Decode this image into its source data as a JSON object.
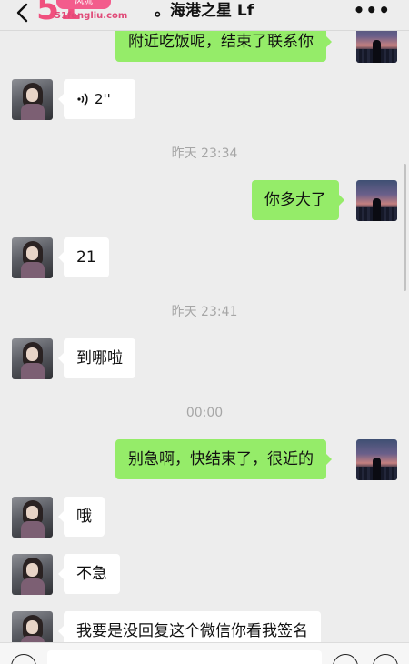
{
  "header": {
    "logo": {
      "number": "51",
      "pill": "风流",
      "url": "51fengliu.com"
    },
    "title": "。海港之星 Lf"
  },
  "messages": [
    {
      "from": "me",
      "text": "附近吃饭呢，结束了联系你"
    },
    {
      "from": "her",
      "type": "voice",
      "duration": "2''"
    },
    {
      "type": "time",
      "text": "昨天 23:34"
    },
    {
      "from": "me",
      "text": "你多大了"
    },
    {
      "from": "her",
      "text": "21"
    },
    {
      "type": "time",
      "text": "昨天 23:41"
    },
    {
      "from": "her",
      "text": "到哪啦"
    },
    {
      "type": "time",
      "text": "00:00"
    },
    {
      "from": "me",
      "text": "别急啊，快结束了，很近的"
    },
    {
      "from": "her",
      "text": "哦"
    },
    {
      "from": "her",
      "text": "不急"
    },
    {
      "from": "her",
      "text": "我要是没回复这个微信你看我签名"
    }
  ],
  "icons": {
    "back": "chevron-left-icon",
    "more": "more-dots-icon",
    "voice_bubble": "voice-wave-icon",
    "voice_input": "voice-input-icon",
    "emoji": "emoji-icon",
    "plus": "plus-icon"
  },
  "colors": {
    "background": "#ededed",
    "outgoing_bubble": "#95ec69",
    "incoming_bubble": "#ffffff",
    "timestamp": "#a6a6a6",
    "logo_pink": "#f0507e"
  }
}
